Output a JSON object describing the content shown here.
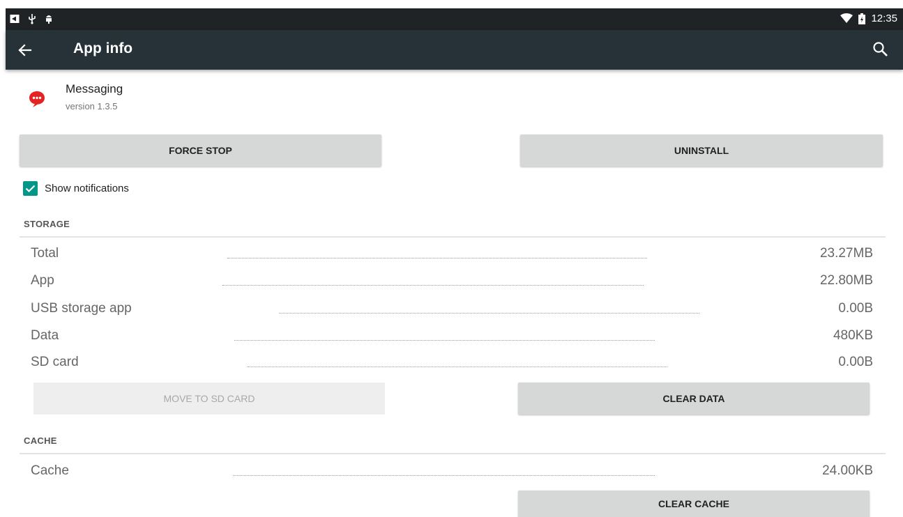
{
  "status_bar": {
    "time": "12:35",
    "left_icons": [
      "notification-icon",
      "usb-icon",
      "android-icon"
    ],
    "right_icons": [
      "wifi-icon",
      "battery-icon"
    ]
  },
  "action_bar": {
    "title": "App info",
    "back_icon": "back-arrow-icon",
    "search_icon": "search-icon"
  },
  "app": {
    "name": "Messaging",
    "version": "version 1.3.5",
    "icon": "messaging-app-icon",
    "icon_color": "#e52323"
  },
  "buttons": {
    "force_stop": "FORCE STOP",
    "uninstall": "UNINSTALL",
    "move_to_sd": "MOVE TO SD CARD",
    "clear_data": "CLEAR DATA",
    "clear_cache": "CLEAR CACHE"
  },
  "notifications": {
    "label": "Show notifications",
    "checked": true,
    "accent": "#009688"
  },
  "storage": {
    "title": "STORAGE",
    "rows": [
      {
        "label": "Total",
        "value": "23.27MB"
      },
      {
        "label": "App",
        "value": "22.80MB"
      },
      {
        "label": "USB storage app",
        "value": "0.00B"
      },
      {
        "label": "Data",
        "value": "480KB"
      },
      {
        "label": "SD card",
        "value": "0.00B"
      }
    ]
  },
  "cache": {
    "title": "CACHE",
    "rows": [
      {
        "label": "Cache",
        "value": "24.00KB"
      }
    ]
  }
}
